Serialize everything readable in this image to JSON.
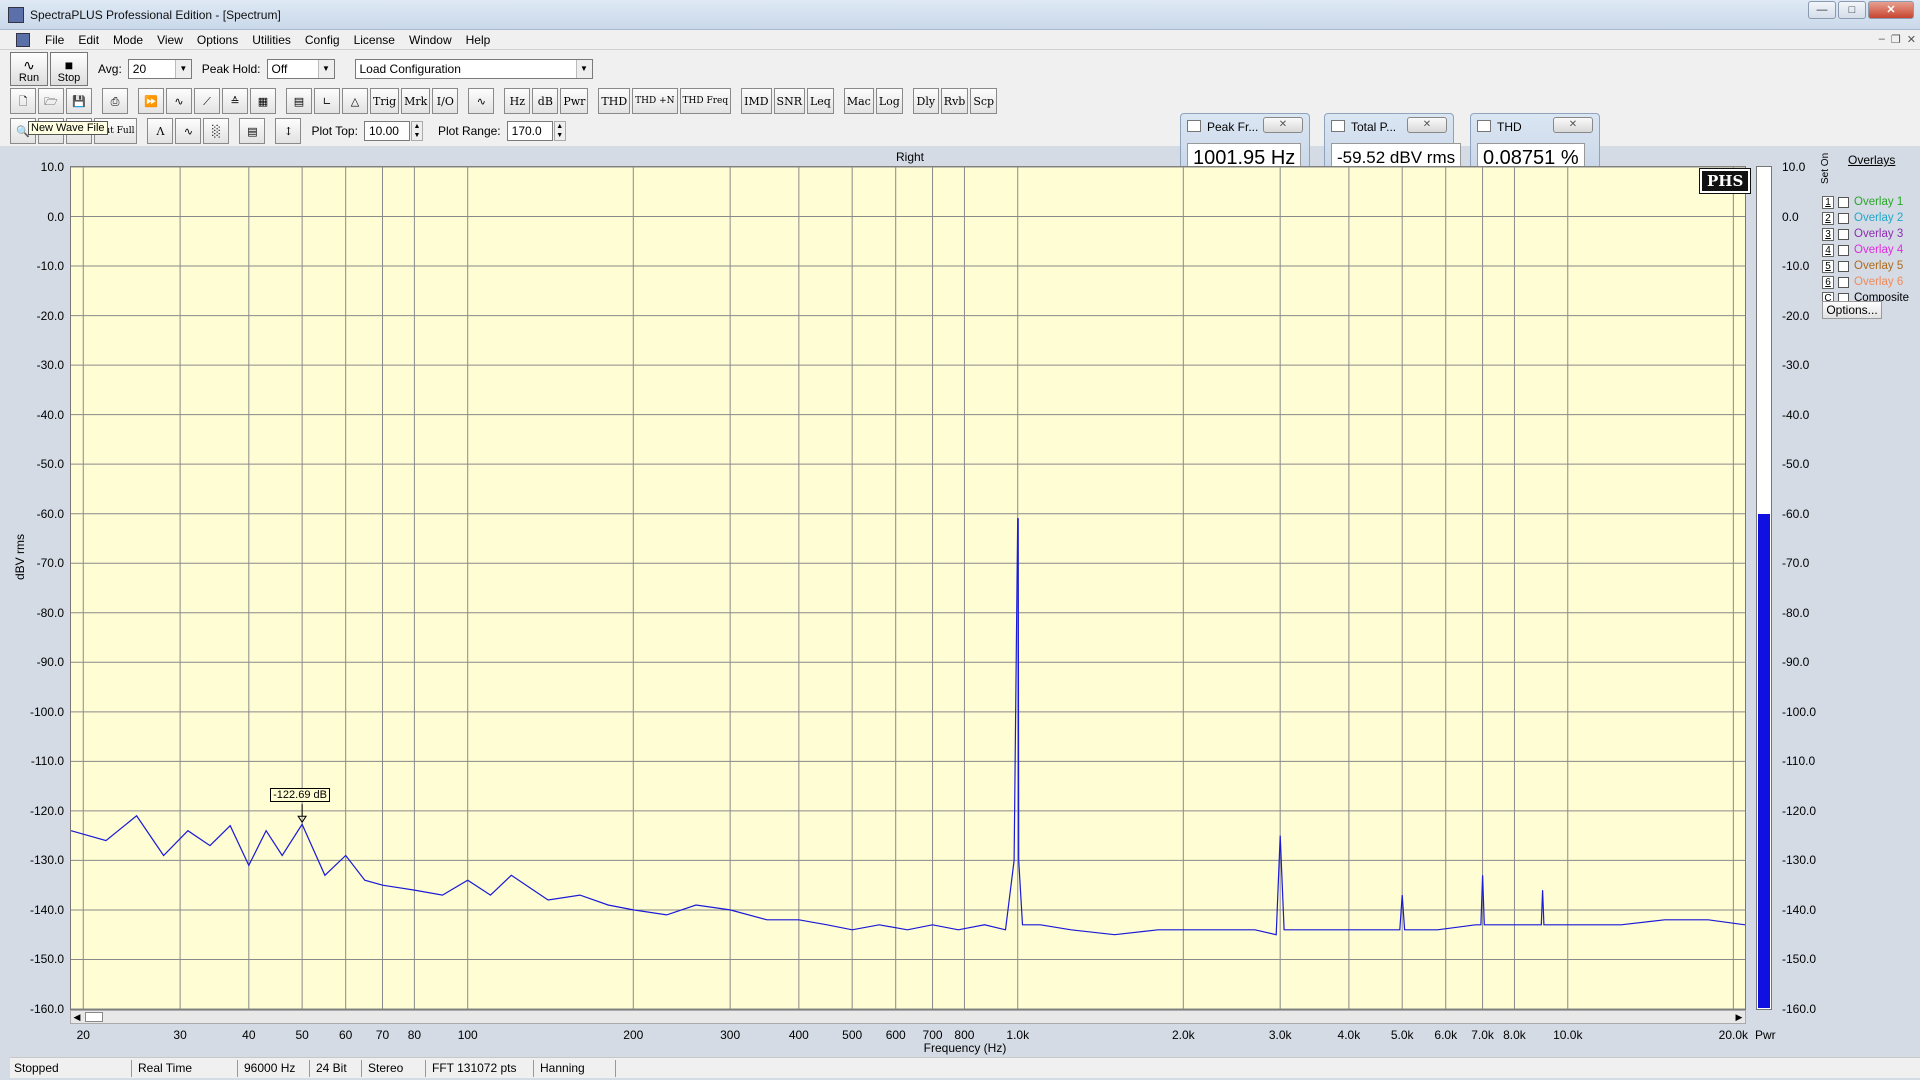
{
  "window": {
    "title": "SpectraPLUS Professional Edition - [Spectrum]"
  },
  "menu": [
    "File",
    "Edit",
    "Mode",
    "View",
    "Options",
    "Utilities",
    "Config",
    "License",
    "Window",
    "Help"
  ],
  "toolbar": {
    "run": "Run",
    "stop": "Stop",
    "avg_label": "Avg:",
    "avg_value": "20",
    "peak_hold_label": "Peak Hold:",
    "peak_hold_value": "Off",
    "load_config": "Load Configuration",
    "buttons_row2": [
      "Trig",
      "Mrk",
      "I/O",
      "Hz",
      "dB",
      "Pwr",
      "THD",
      "THD +N",
      "THD Freq",
      "IMD",
      "SNR",
      "Leq",
      "Mac",
      "Log",
      "Dly",
      "Rvb",
      "Scp"
    ],
    "zoom_out_full": "Out Full",
    "plot_top_label": "Plot Top:",
    "plot_top_value": "10.00",
    "plot_range_label": "Plot Range:",
    "plot_range_value": "170.0",
    "tooltip": "New Wave File"
  },
  "readouts": [
    {
      "title": "Peak Fr...",
      "value": "1001.95 Hz"
    },
    {
      "title": "Total P...",
      "value": "-59.52 dBV rms"
    },
    {
      "title": "THD",
      "value": "0.08751 %"
    }
  ],
  "chart_data": {
    "type": "line",
    "title": "Right",
    "xlabel": "Frequency (Hz)",
    "ylabel": "dBV rms",
    "x_scale": "log",
    "xlim": [
      19,
      21000
    ],
    "ylim": [
      -160,
      10
    ],
    "grid": true,
    "y_ticks": [
      "10.0",
      "0.0",
      "-10.0",
      "-20.0",
      "-30.0",
      "-40.0",
      "-50.0",
      "-60.0",
      "-70.0",
      "-80.0",
      "-90.0",
      "-100.0",
      "-110.0",
      "-120.0",
      "-130.0",
      "-140.0",
      "-150.0",
      "-160.0"
    ],
    "x_ticks": [
      {
        "v": 20,
        "t": "20"
      },
      {
        "v": 30,
        "t": "30"
      },
      {
        "v": 40,
        "t": "40"
      },
      {
        "v": 50,
        "t": "50"
      },
      {
        "v": 60,
        "t": "60"
      },
      {
        "v": 70,
        "t": "70"
      },
      {
        "v": 80,
        "t": "80"
      },
      {
        "v": 100,
        "t": "100"
      },
      {
        "v": 200,
        "t": "200"
      },
      {
        "v": 300,
        "t": "300"
      },
      {
        "v": 400,
        "t": "400"
      },
      {
        "v": 500,
        "t": "500"
      },
      {
        "v": 600,
        "t": "600"
      },
      {
        "v": 700,
        "t": "700"
      },
      {
        "v": 800,
        "t": "800"
      },
      {
        "v": 1000,
        "t": "1.0k"
      },
      {
        "v": 2000,
        "t": "2.0k"
      },
      {
        "v": 3000,
        "t": "3.0k"
      },
      {
        "v": 4000,
        "t": "4.0k"
      },
      {
        "v": 5000,
        "t": "5.0k"
      },
      {
        "v": 6000,
        "t": "6.0k"
      },
      {
        "v": 7000,
        "t": "7.0k"
      },
      {
        "v": 8000,
        "t": "8.0k"
      },
      {
        "v": 10000,
        "t": "10.0k"
      },
      {
        "v": 20000,
        "t": "20.0k"
      }
    ],
    "series": [
      {
        "color": "#1a1ad8",
        "x": [
          19,
          22,
          25,
          28,
          31,
          34,
          37,
          40,
          43,
          46,
          50,
          55,
          60,
          65,
          70,
          80,
          90,
          100,
          110,
          120,
          140,
          160,
          180,
          200,
          230,
          260,
          300,
          350,
          400,
          450,
          500,
          560,
          630,
          700,
          780,
          870,
          950,
          985,
          1000,
          1002,
          1004,
          1020,
          1100,
          1250,
          1500,
          1800,
          2200,
          2700,
          2950,
          3000,
          3050,
          3400,
          4000,
          4700,
          4950,
          5000,
          5050,
          5800,
          6800,
          6950,
          7000,
          7050,
          8200,
          8950,
          9000,
          9050,
          10500,
          12500,
          15000,
          18000,
          21000
        ],
        "y": [
          -124,
          -126,
          -121,
          -129,
          -124,
          -127,
          -123,
          -131,
          -124,
          -129,
          -122.7,
          -133,
          -129,
          -134,
          -135,
          -136,
          -137,
          -134,
          -137,
          -133,
          -138,
          -137,
          -139,
          -140,
          -141,
          -139,
          -140,
          -142,
          -142,
          -143,
          -144,
          -143,
          -144,
          -143,
          -144,
          -143,
          -144,
          -130,
          -61,
          -61,
          -130,
          -143,
          -143,
          -144,
          -145,
          -144,
          -144,
          -144,
          -145,
          -125,
          -144,
          -144,
          -144,
          -144,
          -144,
          -137,
          -144,
          -144,
          -143,
          -143,
          -133,
          -143,
          -143,
          -143,
          -136,
          -143,
          -143,
          -143,
          -142,
          -142,
          -143
        ]
      }
    ],
    "marker": {
      "x": 50,
      "y": -122.69,
      "label": "-122.69 dB"
    },
    "level_meter": {
      "label": "Pwr",
      "value": -60
    }
  },
  "overlays": {
    "heading": "Overlays",
    "set_on_label": "Set On",
    "items": [
      {
        "num": "1",
        "label": "Overlay 1",
        "color": "#2aa52a"
      },
      {
        "num": "2",
        "label": "Overlay 2",
        "color": "#21a7c9"
      },
      {
        "num": "3",
        "label": "Overlay 3",
        "color": "#8c2db0"
      },
      {
        "num": "4",
        "label": "Overlay 4",
        "color": "#e02ce0"
      },
      {
        "num": "5",
        "label": "Overlay 5",
        "color": "#b06a1c"
      },
      {
        "num": "6",
        "label": "Overlay 6",
        "color": "#f08a5a"
      },
      {
        "num": "C",
        "label": "Composite",
        "color": "#000000"
      }
    ],
    "options": "Options..."
  },
  "badge": "PHS",
  "status": [
    "Stopped",
    "Real Time",
    "96000 Hz",
    "24 Bit",
    "Stereo",
    "FFT 131072 pts",
    "Hanning"
  ]
}
